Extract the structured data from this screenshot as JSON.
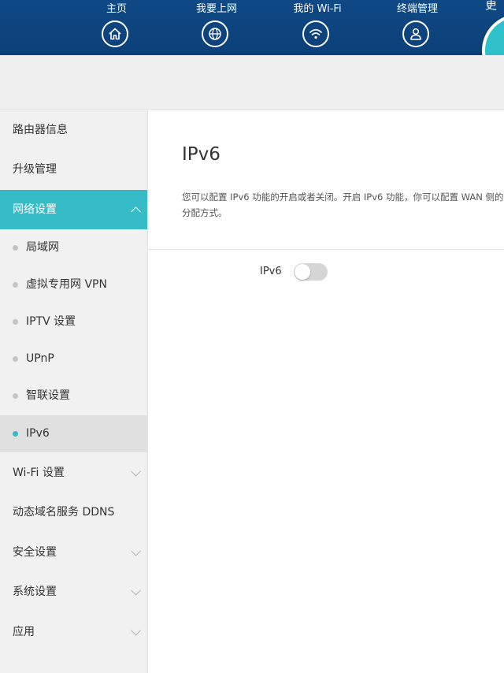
{
  "header": {
    "nav": [
      {
        "label": "主页",
        "icon": "home-icon"
      },
      {
        "label": "我要上网",
        "icon": "globe-icon"
      },
      {
        "label": "我的 Wi-Fi",
        "icon": "wifi-icon"
      },
      {
        "label": "终端管理",
        "icon": "user-icon"
      }
    ],
    "more_label": "更"
  },
  "sidebar": {
    "router_info": "路由器信息",
    "upgrade": "升级管理",
    "network_settings": "网络设置",
    "network_sub": {
      "lan": "局域网",
      "vpn": "虚拟专用网 VPN",
      "iptv": "IPTV 设置",
      "upnp": "UPnP",
      "smart_link": "智联设置",
      "ipv6": "IPv6"
    },
    "wifi_settings": "Wi-Fi 设置",
    "ddns": "动态域名服务 DDNS",
    "security": "安全设置",
    "system": "系统设置",
    "apps": "应用"
  },
  "main": {
    "title": "IPv6",
    "description_line1": "您可以配置 IPv6 功能的开启或者关闭。开启 IPv6 功能，你可以配置 WAN 侧的",
    "description_line2": "分配方式。",
    "ipv6_label": "IPv6",
    "ipv6_enabled": false
  },
  "colors": {
    "header_bg": "#0f4a86",
    "accent": "#35bcc6",
    "toggle_off": "#d5d5d5"
  }
}
